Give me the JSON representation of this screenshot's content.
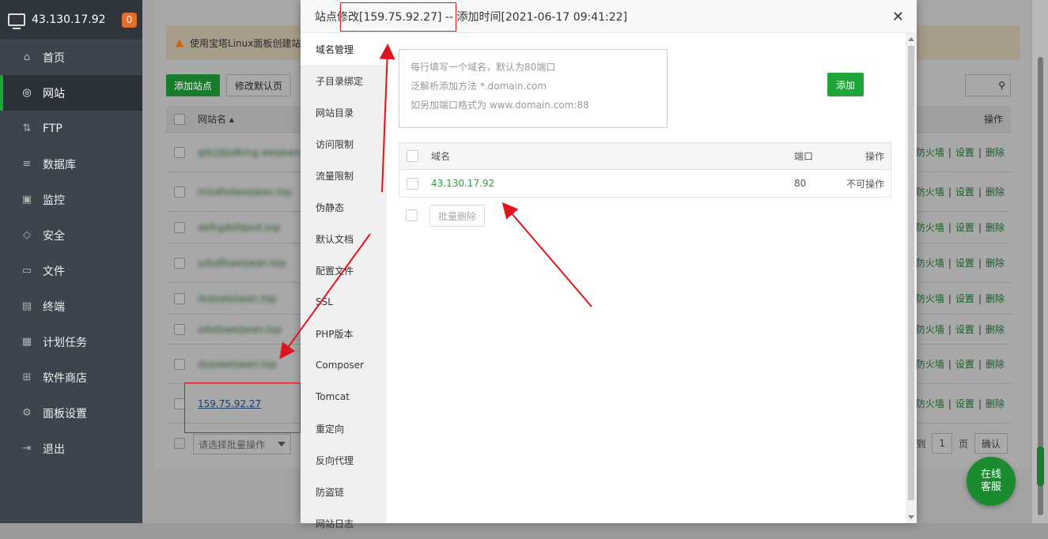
{
  "sidebar": {
    "ip": "43.130.17.92",
    "badge": "0",
    "items": [
      {
        "label": "首页",
        "icon": "home-icon"
      },
      {
        "label": "网站",
        "icon": "globe-icon"
      },
      {
        "label": "FTP",
        "icon": "ftp-icon"
      },
      {
        "label": "数据库",
        "icon": "database-icon"
      },
      {
        "label": "监控",
        "icon": "monitor-icon"
      },
      {
        "label": "安全",
        "icon": "shield-icon"
      },
      {
        "label": "文件",
        "icon": "folder-icon"
      },
      {
        "label": "终端",
        "icon": "terminal-icon"
      },
      {
        "label": "计划任务",
        "icon": "calendar-icon"
      },
      {
        "label": "软件商店",
        "icon": "apps-icon"
      },
      {
        "label": "面板设置",
        "icon": "gear-icon"
      },
      {
        "label": "退出",
        "icon": "logout-icon"
      }
    ]
  },
  "background": {
    "tip": "使用宝塔Linux面板创建站",
    "add_site": "添加站点",
    "default_page": "修改默认页",
    "header_name": "网站名",
    "header_ops": "操作",
    "rows": [
      {
        "name": "gdcjdjsdkmg.weijwan.top",
        "ops": [
          "防火墙",
          "设置",
          "删除"
        ]
      },
      {
        "name": "misdfsdwaijwan.top",
        "ops": [
          "防火墙",
          "设置",
          "删除"
        ]
      },
      {
        "name": "dsfkgdsfdpoit.top",
        "ops": [
          "防火墙",
          "设置",
          "删除"
        ]
      },
      {
        "name": "ydsdfkweijwan.top",
        "ops": [
          "防火墙",
          "设置",
          "删除"
        ]
      },
      {
        "name": "dsasweijwan.top",
        "ops": [
          "防火墙",
          "设置",
          "删除"
        ]
      },
      {
        "name": "sdsdsweijwan.top",
        "ops": [
          "防火墙",
          "设置",
          "删除"
        ]
      },
      {
        "name": "dsasweijwan.top",
        "ops": [
          "防火墙",
          "设置",
          "删除"
        ]
      },
      {
        "name": "159.75.92.27",
        "ops": [
          "防火墙",
          "设置",
          "删除"
        ]
      }
    ],
    "bulk_placeholder": "请选择批量操作",
    "pager": {
      "prefix": "到",
      "page": "1",
      "unit": "页",
      "confirm": "确认"
    },
    "chat": [
      "在线",
      "客服"
    ]
  },
  "modal": {
    "title": "站点修改[159.75.92.27] -- 添加时间[2021-06-17 09:41:22]",
    "nav": [
      "域名管理",
      "子目录绑定",
      "网站目录",
      "访问限制",
      "流量限制",
      "伪静态",
      "默认文档",
      "配置文件",
      "SSL",
      "PHP版本",
      "Composer",
      "Tomcat",
      "重定向",
      "反向代理",
      "防盗链",
      "网站日志"
    ],
    "textarea_placeholder": [
      "每行填写一个域名，默认为80端口",
      "泛解析添加方法 *.domain.com",
      "如另加端口格式为 www.domain.com:88"
    ],
    "add_button": "添加",
    "table_headers": [
      "域名",
      "端口",
      "操作"
    ],
    "domains": [
      {
        "domain": "43.130.17.92",
        "port": "80",
        "op": "不可操作"
      }
    ],
    "bulk_delete": "批量删除"
  }
}
